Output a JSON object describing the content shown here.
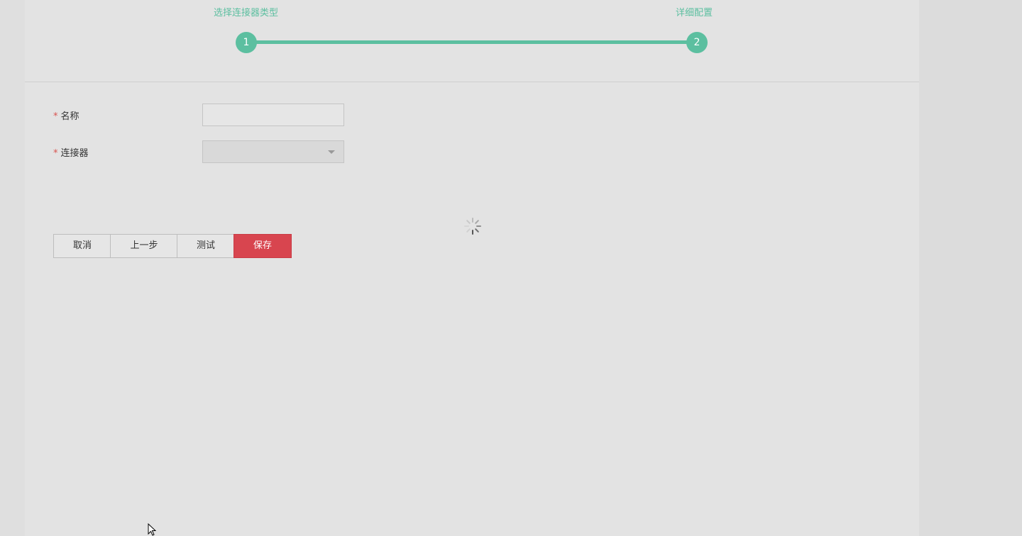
{
  "steps": [
    {
      "label": "选择连接器类型",
      "number": "1"
    },
    {
      "label": "详细配置",
      "number": "2"
    }
  ],
  "form": {
    "name_label": "名称",
    "name_value": "",
    "connector_label": "连接器",
    "connector_value": "",
    "required_mark": "*"
  },
  "buttons": {
    "cancel": "取消",
    "previous": "上一步",
    "test": "测试",
    "save": "保存"
  },
  "colors": {
    "accent": "#5cbfa0",
    "primary_button": "#d8454f",
    "required": "#d9534f"
  }
}
